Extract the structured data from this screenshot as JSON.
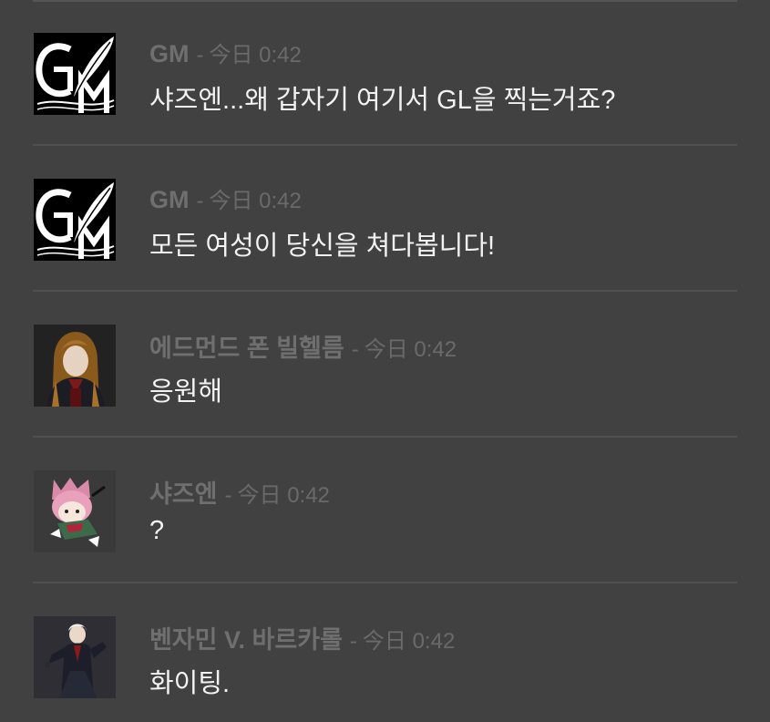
{
  "messages": [
    {
      "username": "GM",
      "separator": "-",
      "timestamp": "今日 0:42",
      "text": "샤즈엔...왜 갑자기 여기서 GL을 찍는거죠?",
      "avatar_icon": "gm-logo-icon"
    },
    {
      "username": "GM",
      "separator": "-",
      "timestamp": "今日 0:42",
      "text": "모든 여성이 당신을 쳐다봅니다!",
      "avatar_icon": "gm-logo-icon"
    },
    {
      "username": "에드먼드 폰 빌헬름",
      "separator": "-",
      "timestamp": "今日 0:42",
      "text": "응원해",
      "avatar_icon": "character-portrait-icon"
    },
    {
      "username": "샤즈엔",
      "separator": "-",
      "timestamp": "今日 0:42",
      "text": "?",
      "avatar_icon": "chibi-character-icon"
    },
    {
      "username": "벤자민 V. 바르카롤",
      "separator": "-",
      "timestamp": "今日 0:42",
      "text": "화이팅.",
      "avatar_icon": "character-portrait-icon"
    }
  ],
  "colors": {
    "background": "#414141",
    "divider": "#505050",
    "username": "#6f6f6f",
    "timestamp": "#6a6a6a",
    "message_text": "#f2f2f2"
  }
}
